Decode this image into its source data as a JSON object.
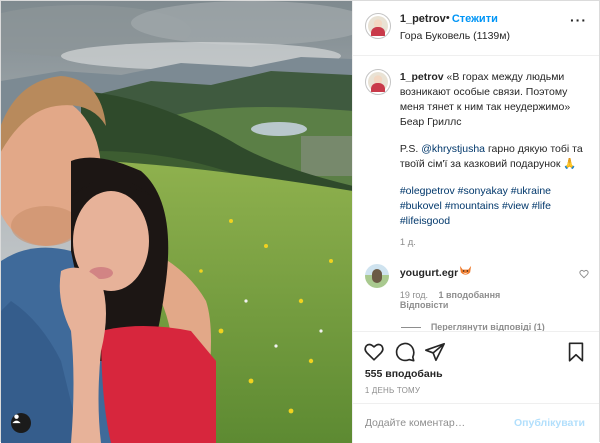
{
  "post": {
    "username": "1_petrov",
    "dot": "•",
    "follow_label": "Стежити",
    "location": "Гора Буковель (1139м)",
    "more_label": "···"
  },
  "caption": {
    "username": "1_petrov",
    "text_ru": "«В горах между людьми возникают особые связи. Поэтому меня тянет к ним так неудержимо» Беар Гриллс",
    "ps_prefix": "P.S.",
    "mention": "@khrystjusha",
    "ps_text": "гарно дякую тобі та твоїй сім'ї за казковий подарунок",
    "emoji": "🙏",
    "hashtags": "#olegpetrov #sonyakay #ukraine #bukovel #mountains #view #life #lifeisgood",
    "time": "1 д."
  },
  "comment": {
    "username": "yougurt.egr",
    "time": "19 год.",
    "likes": "1 вподобання",
    "reply_label": "Відповісти",
    "view_replies": "Переглянути відповіді (1)"
  },
  "stats": {
    "likes": "555 вподобань",
    "date": "1 ДЕНЬ ТОМУ"
  },
  "add_comment": {
    "placeholder": "Додайте коментар…",
    "post_label": "Опублікувати"
  },
  "icons": {
    "like": "heart-outline-icon",
    "comment": "speech-bubble-icon",
    "share": "paper-plane-icon",
    "save": "bookmark-icon",
    "comment_like": "small-heart-icon",
    "tag": "person-tag-icon",
    "emoji": "fox-emoji-icon"
  },
  "colors": {
    "link_blue": "#0095f6",
    "mention_blue": "#00376b",
    "muted": "#8e8e8e",
    "post_button_disabled": "#b2dffc"
  }
}
